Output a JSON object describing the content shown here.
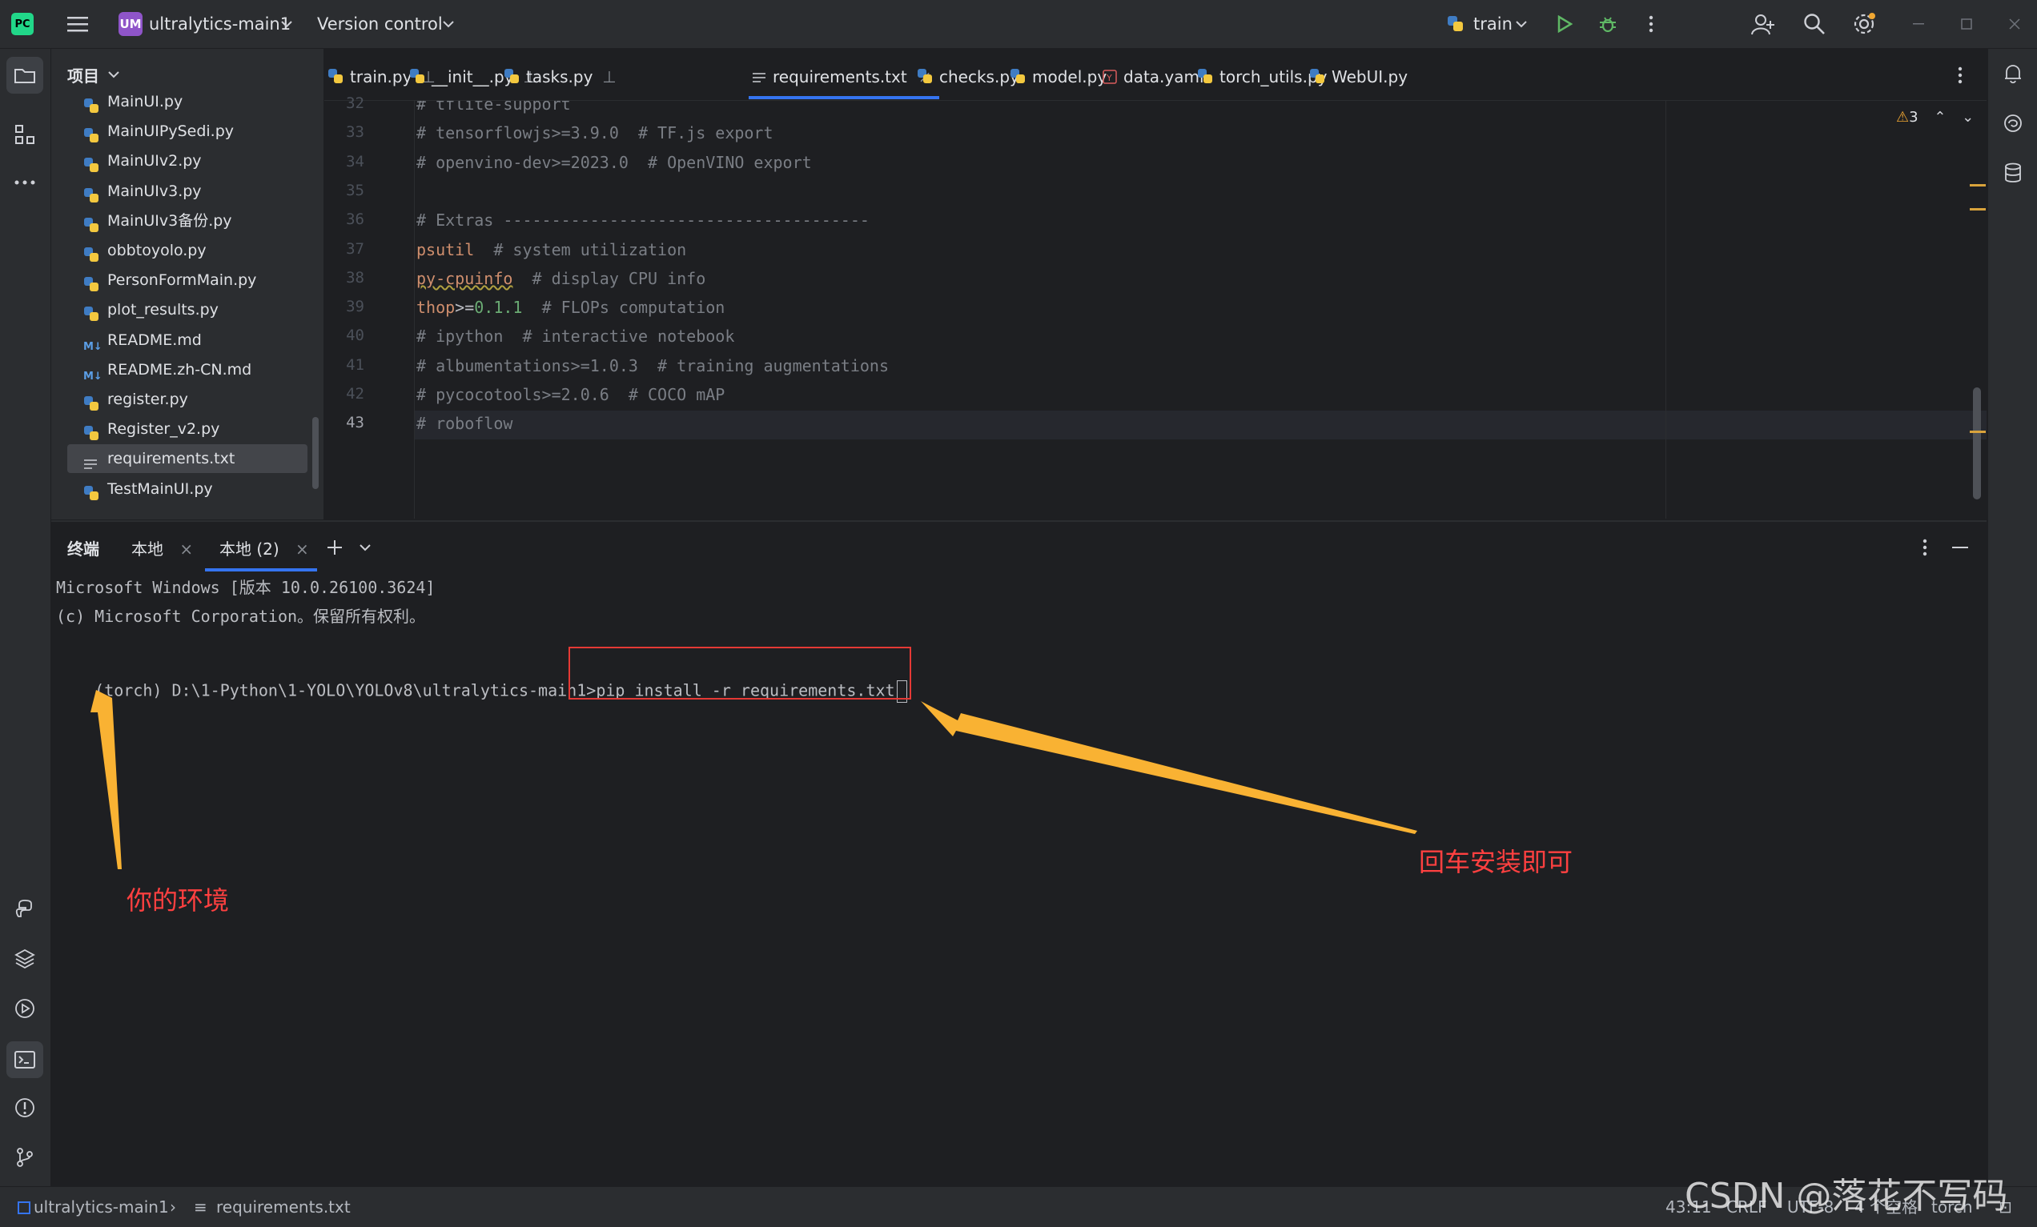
{
  "titlebar": {
    "project_badge": "UM",
    "project_name": "ultralytics-main1",
    "vcs": "Version control",
    "run_config": "train"
  },
  "project_panel": {
    "title": "项目",
    "files": [
      {
        "name": "MainUI.py",
        "type": "py"
      },
      {
        "name": "MainUIPySedi.py",
        "type": "py"
      },
      {
        "name": "MainUIv2.py",
        "type": "py"
      },
      {
        "name": "MainUIv3.py",
        "type": "py"
      },
      {
        "name": "MainUIv3备份.py",
        "type": "py"
      },
      {
        "name": "obbtoyolo.py",
        "type": "py"
      },
      {
        "name": "PersonFormMain.py",
        "type": "py"
      },
      {
        "name": "plot_results.py",
        "type": "py"
      },
      {
        "name": "README.md",
        "type": "md"
      },
      {
        "name": "README.zh-CN.md",
        "type": "md"
      },
      {
        "name": "register.py",
        "type": "py"
      },
      {
        "name": "Register_v2.py",
        "type": "py"
      },
      {
        "name": "requirements.txt",
        "type": "txt",
        "selected": true
      },
      {
        "name": "TestMainUI.py",
        "type": "py"
      }
    ]
  },
  "editor": {
    "tabs": [
      {
        "label": "train.py",
        "type": "py",
        "pinned": true
      },
      {
        "label": "__init__.py",
        "type": "py",
        "pinned": true
      },
      {
        "label": "tasks.py",
        "type": "py",
        "pinned": true
      },
      {
        "label": "requirements.txt",
        "type": "txt",
        "active": true
      },
      {
        "label": "checks.py",
        "type": "py"
      },
      {
        "label": "model.py",
        "type": "py"
      },
      {
        "label": "data.yaml",
        "type": "yaml"
      },
      {
        "label": "torch_utils.py",
        "type": "py"
      },
      {
        "label": "WebUI.py",
        "type": "py"
      }
    ],
    "warnings": "3",
    "lines": [
      {
        "n": "32",
        "text": "# tflite-support"
      },
      {
        "n": "33",
        "text": "# tensorflowjs>=3.9.0  # TF.js export"
      },
      {
        "n": "34",
        "text": "# openvino-dev>=2023.0  # OpenVINO export"
      },
      {
        "n": "35",
        "text": ""
      },
      {
        "n": "36",
        "text": "# Extras --------------------------------------"
      },
      {
        "n": "37",
        "pkg": "psutil",
        "rest": "  # system utilization"
      },
      {
        "n": "38",
        "pkg": "py-cpuinfo",
        "rest": "  # display CPU info"
      },
      {
        "n": "39",
        "pkg": "thop",
        "op": ">=",
        "ver": "0.1.1",
        "rest": "  # FLOPs computation"
      },
      {
        "n": "40",
        "text": "# ipython  # interactive notebook"
      },
      {
        "n": "41",
        "text": "# albumentations>=1.0.3  # training augmentations"
      },
      {
        "n": "42",
        "text": "# pycocotools>=2.0.6  # COCO mAP"
      },
      {
        "n": "43",
        "text": "# roboflow"
      }
    ]
  },
  "terminal": {
    "title": "终端",
    "tabs": [
      "本地",
      "本地 (2)"
    ],
    "lines": [
      "Microsoft Windows [版本 10.0.26100.3624]",
      "(c) Microsoft Corporation。保留所有权利。",
      ""
    ],
    "prompt": "(torch) D:\\1-Python\\1-YOLO\\YOLOv8\\ultralytics-main1>",
    "command": "pip install -r requirements.txt"
  },
  "annotations": {
    "env_label": "你的环境",
    "enter_label": "回车安装即可",
    "color": "#ff3b3b",
    "arrow_color": "#f9b233"
  },
  "statusbar": {
    "project": "ultralytics-main1",
    "file": "requirements.txt",
    "position": "43:11",
    "line_sep": "CRLF",
    "encoding": "UTF-8",
    "indent": "4 个空格",
    "interpreter": "torch"
  },
  "watermark": "CSDN @落花不写码"
}
